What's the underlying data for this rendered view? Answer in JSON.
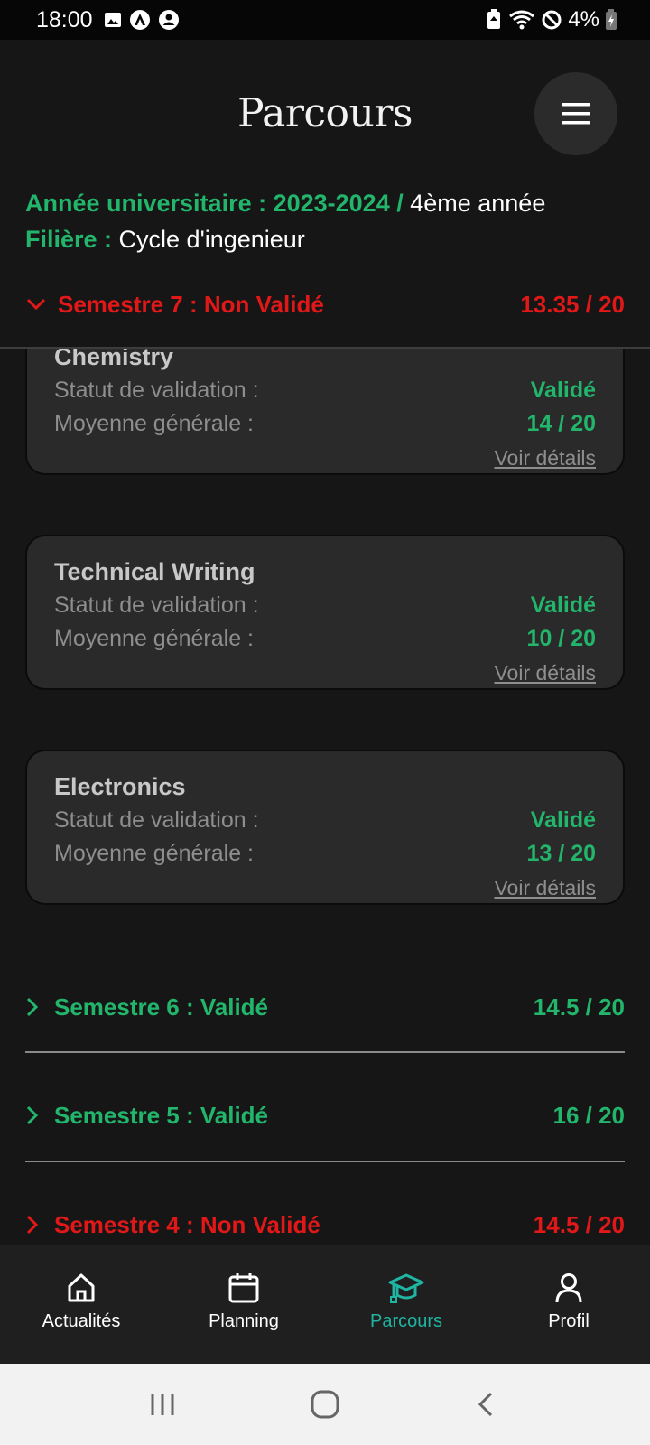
{
  "status_bar": {
    "time": "18:00",
    "battery": "4%"
  },
  "header": {
    "title": "Parcours",
    "menu_icon": "hamburger-menu-icon"
  },
  "info": {
    "year_label": "Année universitaire : 2023-2024 /",
    "year_value": " 4ème année",
    "field_label": "Filière :",
    "field_value": " Cycle d'ingenieur"
  },
  "semester7": {
    "label": "Semestre 7 : Non Validé",
    "grade": "13.35 / 20"
  },
  "courses": [
    {
      "name": "Chemistry",
      "status_label": "Statut de validation :",
      "status": "Validé",
      "avg_label": "Moyenne générale :",
      "avg": "14 / 20",
      "link": "Voir détails"
    },
    {
      "name": "Technical Writing",
      "status_label": "Statut de validation :",
      "status": "Validé",
      "avg_label": "Moyenne générale :",
      "avg": "10 / 20",
      "link": "Voir détails"
    },
    {
      "name": "Electronics",
      "status_label": "Statut de validation :",
      "status": "Validé",
      "avg_label": "Moyenne générale :",
      "avg": "13 / 20",
      "link": "Voir détails"
    }
  ],
  "semesters": [
    {
      "label": "Semestre 6 : Validé",
      "grade": "14.5 / 20",
      "status_color": "#22b56b"
    },
    {
      "label": "Semestre 5 : Validé",
      "grade": "16 / 20",
      "status_color": "#22b56b"
    },
    {
      "label": "Semestre 4 : Non Validé",
      "grade": "14.5 / 20",
      "status_color": "#e01818"
    }
  ],
  "bottom_nav": [
    {
      "label": "Actualités",
      "icon": "home-icon"
    },
    {
      "label": "Planning",
      "icon": "calendar-icon"
    },
    {
      "label": "Parcours",
      "icon": "graduation-cap-icon",
      "active": true
    },
    {
      "label": "Profil",
      "icon": "user-icon"
    }
  ],
  "colors": {
    "valid": "#22b56b",
    "invalid": "#e01818",
    "active_tab": "#1fb5a2"
  }
}
